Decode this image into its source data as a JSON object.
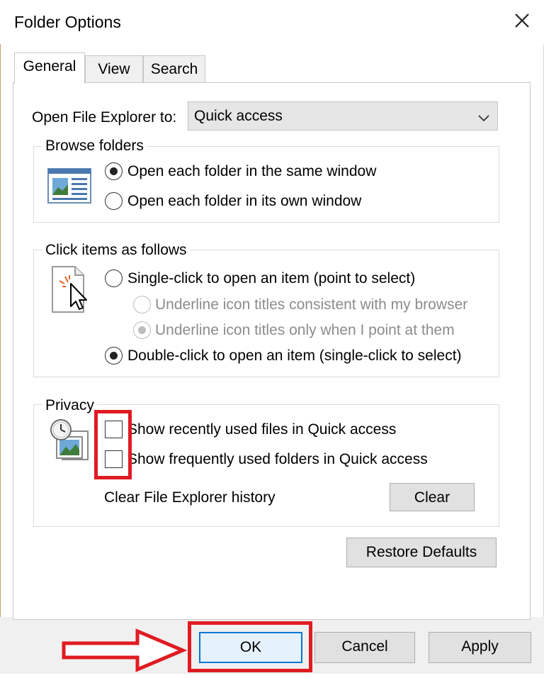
{
  "window": {
    "title": "Folder Options",
    "close_icon": "close-icon"
  },
  "tabs": [
    {
      "label": "General",
      "active": true
    },
    {
      "label": "View",
      "active": false
    },
    {
      "label": "Search",
      "active": false
    }
  ],
  "general": {
    "open_explorer_label": "Open File Explorer to:",
    "open_explorer_value": "Quick access",
    "browse_folders": {
      "legend": "Browse folders",
      "icon": "browse-folders-icon",
      "options": [
        {
          "label": "Open each folder in the same window",
          "checked": true
        },
        {
          "label": "Open each folder in its own window",
          "checked": false
        }
      ]
    },
    "click_items": {
      "legend": "Click items as follows",
      "icon": "cursor-click-icon",
      "options": [
        {
          "label": "Single-click to open an item (point to select)",
          "checked": false,
          "disabled": false
        },
        {
          "label": "Underline icon titles consistent with my browser",
          "checked": false,
          "disabled": true
        },
        {
          "label": "Underline icon titles only when I point at them",
          "checked": true,
          "disabled": true
        },
        {
          "label": "Double-click to open an item (single-click to select)",
          "checked": true,
          "disabled": false
        }
      ]
    },
    "privacy": {
      "legend": "Privacy",
      "icon": "privacy-clock-icon",
      "options": [
        {
          "label": "Show recently used files in Quick access",
          "checked": false
        },
        {
          "label": "Show frequently used folders in Quick access",
          "checked": false
        }
      ],
      "clear_history_label": "Clear File Explorer history",
      "clear_button": "Clear"
    },
    "restore_defaults_button": "Restore Defaults"
  },
  "footer": {
    "ok_button": "OK",
    "cancel_button": "Cancel",
    "apply_button": "Apply"
  },
  "annotations": {
    "highlight_color": "#e01b23"
  }
}
